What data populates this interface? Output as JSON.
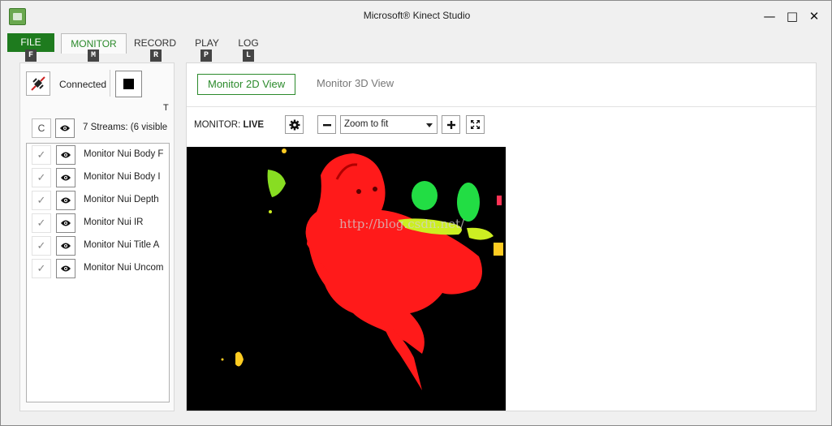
{
  "window": {
    "title": "Microsoft® Kinect Studio",
    "controls": {
      "minimize": "—",
      "maximize": "□",
      "close": "✕"
    }
  },
  "menu": {
    "file": "FILE",
    "tabs": [
      "MONITOR",
      "RECORD",
      "PLAY",
      "LOG"
    ],
    "active_tab": "MONITOR",
    "keytips": [
      "F",
      "M",
      "R",
      "P",
      "L"
    ]
  },
  "connection": {
    "status": "Connected",
    "connect_icon": "plug-connect-icon",
    "stop_icon": "stop-icon",
    "truncated_text": "T"
  },
  "streams": {
    "refresh_label": "C",
    "summary": "7 Streams: (6 visible",
    "items": [
      {
        "name": "Monitor Nui Body F",
        "checked": true,
        "visible": true
      },
      {
        "name": "Monitor Nui Body I",
        "checked": true,
        "visible": true
      },
      {
        "name": "Monitor Nui Depth",
        "checked": true,
        "visible": true
      },
      {
        "name": "Monitor Nui IR",
        "checked": true,
        "visible": true
      },
      {
        "name": "Monitor Nui Title A",
        "checked": true,
        "visible": true
      },
      {
        "name": "Monitor Nui Uncom",
        "checked": true,
        "visible": true
      }
    ]
  },
  "monitor": {
    "view_tabs": [
      "Monitor 2D View",
      "Monitor 3D View"
    ],
    "active_view": "Monitor 2D View",
    "label_prefix": "MONITOR:",
    "label_state": "LIVE",
    "zoom_value": "Zoom to fit",
    "watermark": "http://blog.csdn.net/"
  },
  "colors": {
    "accent_green": "#2b8a2b",
    "file_green": "#1e7b1e",
    "depth_red": "#ff1a1a",
    "depth_green": "#22dd44",
    "depth_yellow": "#ccee22"
  }
}
